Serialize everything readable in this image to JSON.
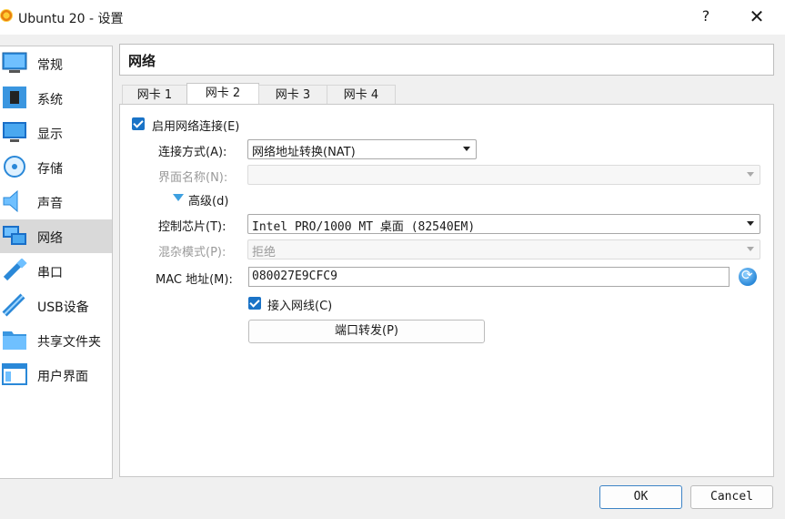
{
  "window": {
    "title": "Ubuntu 20 - 设置",
    "help": "?",
    "close": "✕"
  },
  "sidebar": {
    "items": [
      {
        "label": "常规",
        "icon": "general-icon"
      },
      {
        "label": "系统",
        "icon": "system-icon"
      },
      {
        "label": "显示",
        "icon": "display-icon"
      },
      {
        "label": "存储",
        "icon": "storage-icon"
      },
      {
        "label": "声音",
        "icon": "audio-icon"
      },
      {
        "label": "网络",
        "icon": "network-icon",
        "selected": true
      },
      {
        "label": "串口",
        "icon": "serial-port-icon"
      },
      {
        "label": "USB设备",
        "icon": "usb-icon"
      },
      {
        "label": "共享文件夹",
        "icon": "shared-folder-icon"
      },
      {
        "label": "用户界面",
        "icon": "user-interface-icon"
      }
    ]
  },
  "page": {
    "title": "网络"
  },
  "tabs": [
    {
      "label": "网卡 1"
    },
    {
      "label": "网卡 2",
      "active": true
    },
    {
      "label": "网卡 3"
    },
    {
      "label": "网卡 4"
    }
  ],
  "form": {
    "enable_label": "启用网络连接(E)",
    "enable_checked": true,
    "attach_label": "连接方式(A):",
    "attach_value": "网络地址转换(NAT)",
    "name_label": "界面名称(N):",
    "name_value": "",
    "advanced_label": "高级(d)",
    "adapter_label": "控制芯片(T):",
    "adapter_value": "Intel PRO/1000 MT 桌面 (82540EM)",
    "promisc_label": "混杂模式(P):",
    "promisc_value": "拒绝",
    "mac_label": "MAC 地址(M):",
    "mac_value": "080027E9CFC9",
    "cable_label": "接入网线(C)",
    "cable_checked": true,
    "port_forward_label": "端口转发(P)"
  },
  "footer": {
    "ok": "OK",
    "cancel": "Cancel"
  },
  "colors": {
    "accent": "#1a73c7",
    "selected_bg": "#d9d9d9"
  }
}
